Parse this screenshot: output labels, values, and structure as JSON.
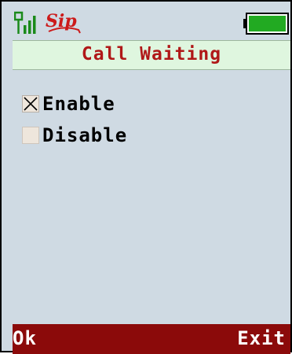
{
  "status_bar": {
    "signal_icon": "signal-strength-icon",
    "logo_text": "Sip",
    "battery_icon": "battery-full-icon",
    "battery_level": 1.0
  },
  "screen": {
    "title": "Call Waiting"
  },
  "options": [
    {
      "label": "Enable",
      "checked": true
    },
    {
      "label": "Disable",
      "checked": false
    }
  ],
  "softkeys": {
    "left": "Ok",
    "right": "Exit"
  },
  "colors": {
    "title_text": "#b01818",
    "title_bar_bg": "#dff6df",
    "screen_bg": "#cfdae3",
    "softkey_bar_bg": "#8b0a0a",
    "battery_fill": "#22aa22",
    "signal_icon": "#1a8a1a",
    "logo": "#cc1a1a"
  }
}
